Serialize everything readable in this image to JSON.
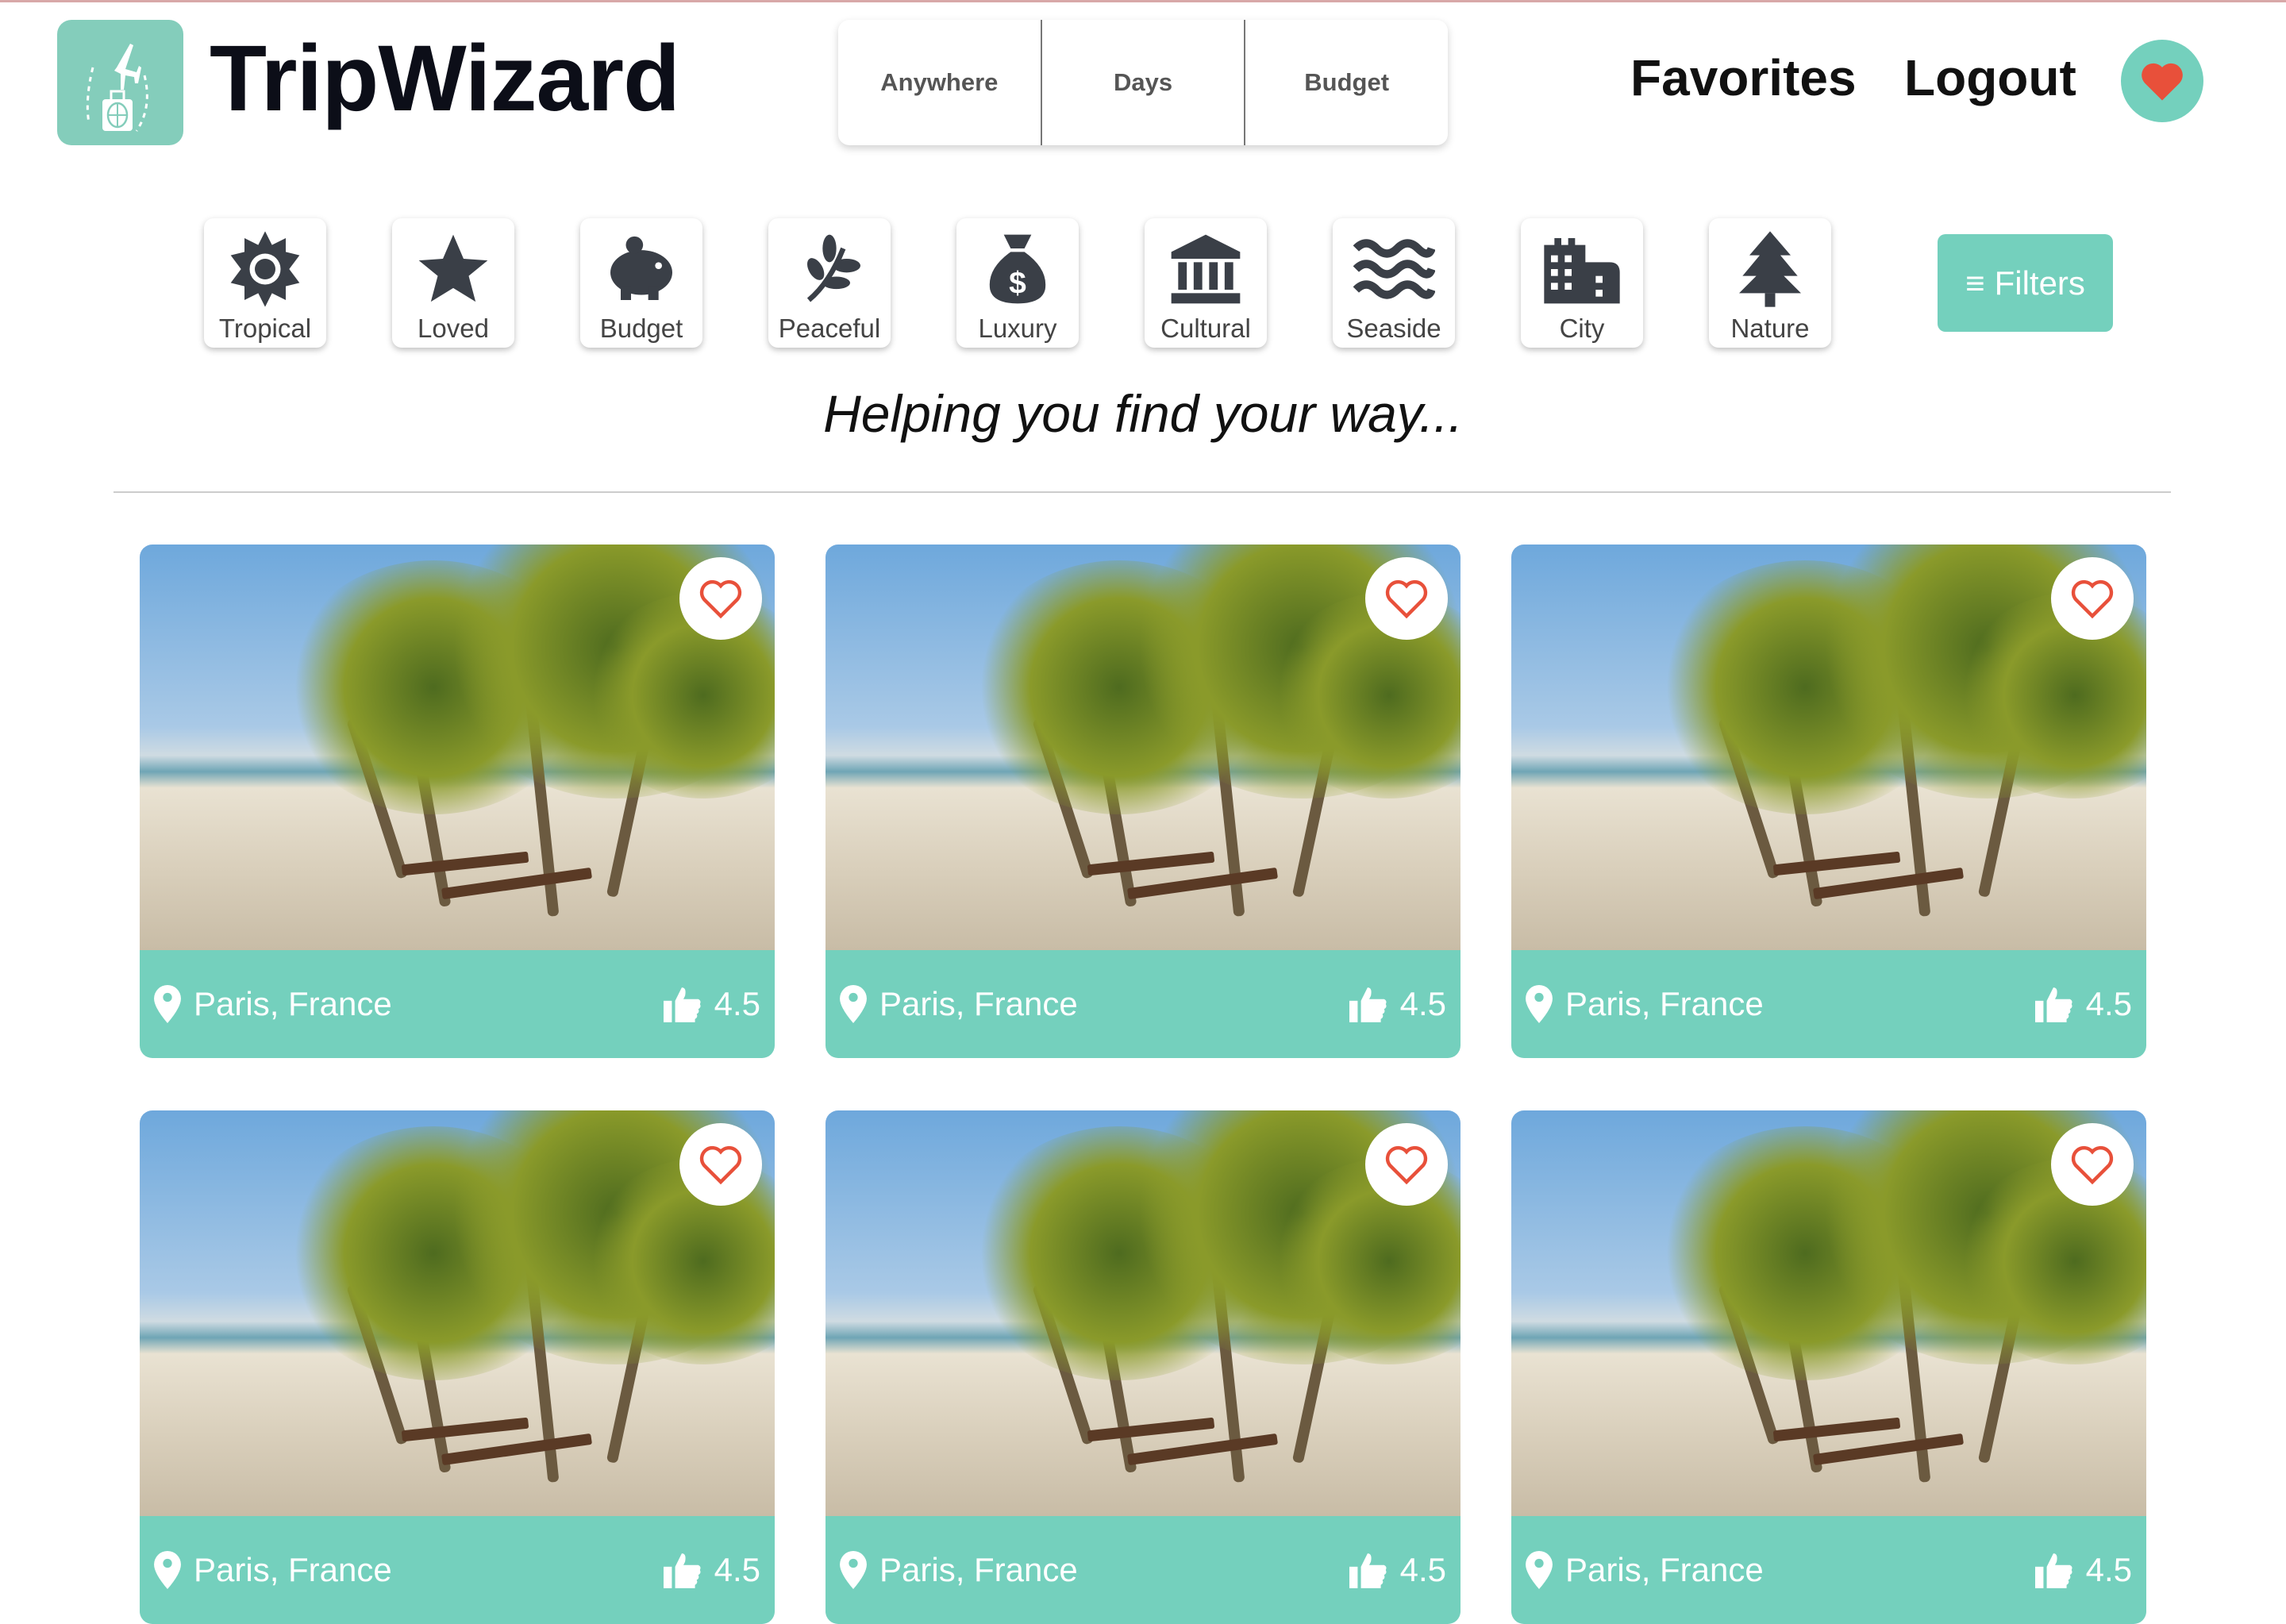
{
  "header": {
    "brand": "TripWizard",
    "search": {
      "where": "Anywhere",
      "days": "Days",
      "budget": "Budget"
    },
    "favorites": "Favorites",
    "logout": "Logout"
  },
  "categories": [
    {
      "label": "Tropical",
      "icon": "sun-icon"
    },
    {
      "label": "Loved",
      "icon": "star-icon"
    },
    {
      "label": "Budget",
      "icon": "piggy-bank-icon"
    },
    {
      "label": "Peaceful",
      "icon": "seedling-icon"
    },
    {
      "label": "Luxury",
      "icon": "money-bag-icon"
    },
    {
      "label": "Cultural",
      "icon": "landmark-icon"
    },
    {
      "label": "Seaside",
      "icon": "waves-icon"
    },
    {
      "label": "City",
      "icon": "city-icon"
    },
    {
      "label": "Nature",
      "icon": "tree-icon"
    }
  ],
  "filters_label": "Filters",
  "tagline": "Helping you find your way...",
  "cards": [
    {
      "location": "Paris, France",
      "rating": "4.5"
    },
    {
      "location": "Paris, France",
      "rating": "4.5"
    },
    {
      "location": "Paris, France",
      "rating": "4.5"
    },
    {
      "location": "Paris, France",
      "rating": "4.5"
    },
    {
      "location": "Paris, France",
      "rating": "4.5"
    },
    {
      "location": "Paris, France",
      "rating": "4.5"
    }
  ],
  "colors": {
    "accent": "#74d0bd",
    "heart": "#e8503a"
  }
}
